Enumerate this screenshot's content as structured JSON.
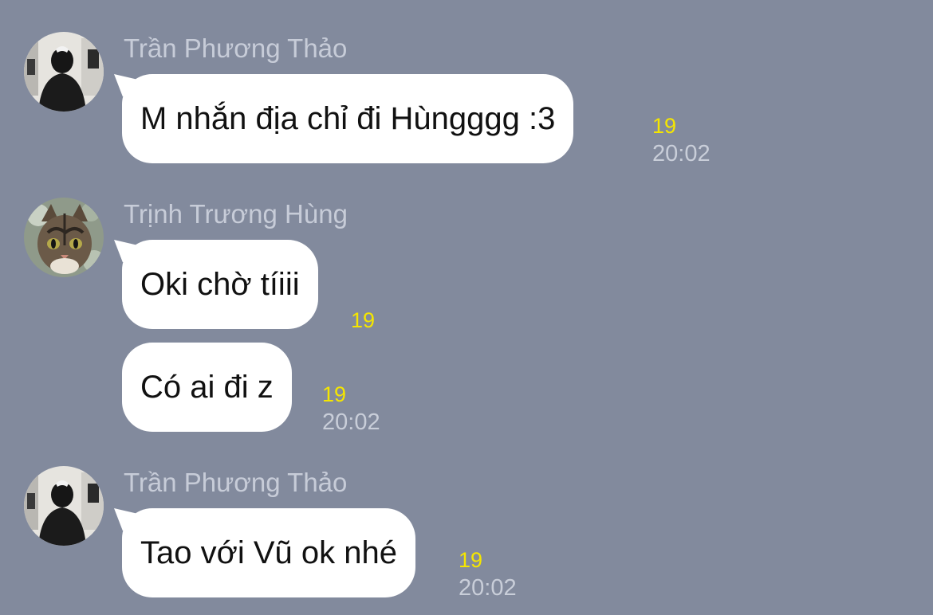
{
  "chat": {
    "messages": [
      {
        "sender": "Trần Phương Thảo",
        "text": "M nhắn địa chỉ đi Hùngggg :3",
        "read_count": "19",
        "time": "20:02"
      },
      {
        "sender": "Trịnh Trương Hùng",
        "text": "Oki chờ tíiii",
        "read_count": "19",
        "time": ""
      },
      {
        "sender": "",
        "text": "Có ai đi z",
        "read_count": "19",
        "time": "20:02"
      },
      {
        "sender": "Trần Phương Thảo",
        "text": "Tao với Vũ ok nhé",
        "read_count": "19",
        "time": "20:02"
      }
    ]
  },
  "colors": {
    "background": "#828a9d",
    "bubble": "#ffffff",
    "read_count": "#f5e600",
    "meta_text": "#c9ced9"
  },
  "icons": {
    "avatar_thao": "person-photo-avatar",
    "avatar_hung": "cat-photo-avatar"
  }
}
